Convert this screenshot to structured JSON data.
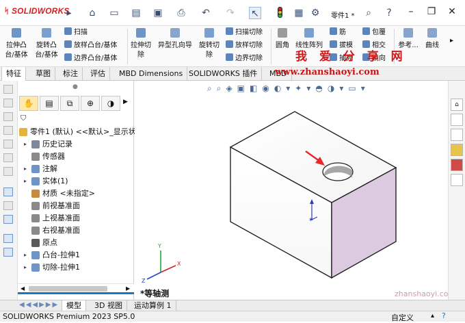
{
  "app": {
    "brand": "SOLIDWORKS"
  },
  "quickbar": {
    "doc_name": "零件1 *",
    "icons": [
      "home-icon",
      "new-icon",
      "open-icon",
      "save-icon",
      "print-icon",
      "undo-icon",
      "redo-icon",
      "select-icon",
      "traffic-light-icon",
      "rebuild-icon",
      "options-icon"
    ]
  },
  "ribbon": {
    "extrude_boss": "拉伸凸台/基体",
    "revolve_boss": "旋转凸台/基体",
    "sweep": "扫描",
    "loft_boss": "放样凸台/基体",
    "boundary_boss": "边界凸台/基体",
    "extrude_cut": "拉伸切除",
    "hole_wizard": "异型孔向导",
    "revolve_cut": "旋转切除",
    "sweep_cut": "扫描切除",
    "loft_cut": "放样切除",
    "boundary_cut": "边界切除",
    "fillet": "圆角",
    "linear_pattern": "线性阵列",
    "rib": "筋",
    "draft": "拔模",
    "shell": "抽壳",
    "wrap": "包覆",
    "intersect": "相交",
    "mirror": "镜向",
    "reference": "参考...",
    "curves": "曲线"
  },
  "watermark": {
    "title": "我 爱 分 享 网",
    "url": "www.zhanshaoyi.com",
    "url_bottom": "zhanshaoyi.com"
  },
  "tabs": [
    "特征",
    "草图",
    "标注",
    "评估",
    "MBD Dimensions",
    "SOLIDWORKS 插件",
    "MBD"
  ],
  "feature_tree": {
    "root": "零件1 (默认) <<默认>_显示状",
    "items": [
      {
        "label": "历史记录",
        "arrow": "▸"
      },
      {
        "label": "传感器",
        "arrow": ""
      },
      {
        "label": "注解",
        "arrow": "▸"
      },
      {
        "label": "实体(1)",
        "arrow": "▸"
      },
      {
        "label": "材质 <未指定>",
        "arrow": ""
      },
      {
        "label": "前视基准面",
        "arrow": ""
      },
      {
        "label": "上视基准面",
        "arrow": ""
      },
      {
        "label": "右视基准面",
        "arrow": ""
      },
      {
        "label": "原点",
        "arrow": ""
      },
      {
        "label": "凸台-拉伸1",
        "arrow": "▸"
      },
      {
        "label": "切除-拉伸1",
        "arrow": "▸"
      }
    ]
  },
  "viewport": {
    "view_label": "*等轴测",
    "axis_x": "X",
    "axis_y": "Y",
    "axis_z": "Z"
  },
  "bottom_tabs": [
    "模型",
    "3D 视图",
    "运动算例 1"
  ],
  "status": {
    "version": "SOLIDWORKS Premium 2023 SP5.0",
    "custom": "自定义"
  },
  "colors": {
    "brand_red": "#d81e1e",
    "selection_blue": "#1c74c4",
    "face_pink": "#dccbe0"
  }
}
